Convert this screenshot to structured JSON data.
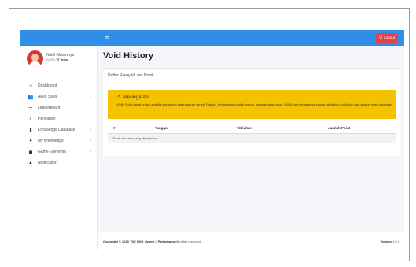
{
  "topbar": {
    "menu_icon": "hamburger-icon",
    "logout_label": "Logout"
  },
  "user": {
    "name": "Nabil Almorroya",
    "class_label": "XII-IPA /",
    "role": "IT Helkat"
  },
  "sidebar": {
    "items": [
      {
        "label": "Dashboard",
        "icon": "home-icon",
        "has_submenu": false
      },
      {
        "label": "Akun Saya",
        "icon": "users-icon",
        "has_submenu": true
      },
      {
        "label": "Leaderboard",
        "icon": "list-icon",
        "has_submenu": false
      },
      {
        "label": "Pencarian",
        "icon": "search-icon",
        "has_submenu": false
      },
      {
        "label": "Knowledge Database",
        "icon": "book-icon",
        "has_submenu": true
      },
      {
        "label": "My Knowledge",
        "icon": "globe-icon",
        "has_submenu": true
      },
      {
        "label": "Game Elements",
        "icon": "gamepad-icon",
        "has_submenu": true
      },
      {
        "label": "Notification",
        "icon": "bell-icon",
        "has_submenu": false
      }
    ]
  },
  "main": {
    "page_title": "Void History",
    "card_title": "Daftar Riwayat Loss Point",
    "alert": {
      "title": "Peringatan!",
      "text": "VOID Point dapat terjadi apabila ditemukan pelanggaran seperti Plagiat, Pengetahuan tidak sesuai, mengandung unsur SARA dan sebagainya sesuai kebijakan kurikulum dan silabus mata pelajaran.",
      "close": "×"
    },
    "table": {
      "columns": [
        "#",
        "Tanggal",
        "Aktivitas",
        "Jumlah Point"
      ],
      "empty_message": "Tidak ada data yang ditampilkan"
    }
  },
  "footer": {
    "copyright_prefix": "Copyright © 2020 TKJ SMK Negeri 2 Palembang",
    "rights": "All rights reserved.",
    "version_label": "Version",
    "version_number": "1.0.1"
  }
}
